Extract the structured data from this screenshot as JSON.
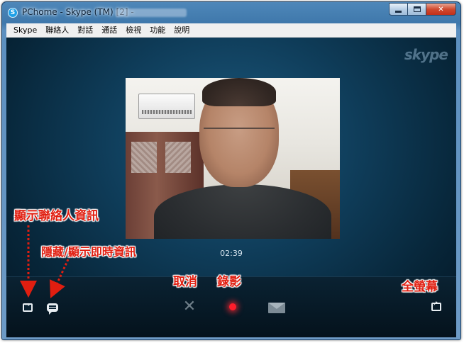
{
  "window": {
    "title": "PChome - Skype (TM) [2] -",
    "icon": "skype-icon",
    "buttons": [
      "minimize",
      "maximize",
      "close"
    ]
  },
  "menubar": {
    "items": [
      "Skype",
      "聯絡人",
      "對話",
      "通話",
      "檢視",
      "功能",
      "說明"
    ]
  },
  "call": {
    "logo_text": "skype",
    "timer": "02:39"
  },
  "controls": {
    "icons": [
      "show-contacts-icon",
      "chat-icon",
      "hangup-x-icon",
      "record-icon",
      "send-message-icon",
      "fullscreen-icon"
    ],
    "record_color": "#ff1d2b"
  },
  "annotations": {
    "show_contacts": "顯示聯絡人資訊",
    "toggle_im": "隱藏/顯示即時資訊",
    "cancel": "取消",
    "record": "錄影",
    "fullscreen": "全螢幕",
    "color": "#e01e10"
  }
}
